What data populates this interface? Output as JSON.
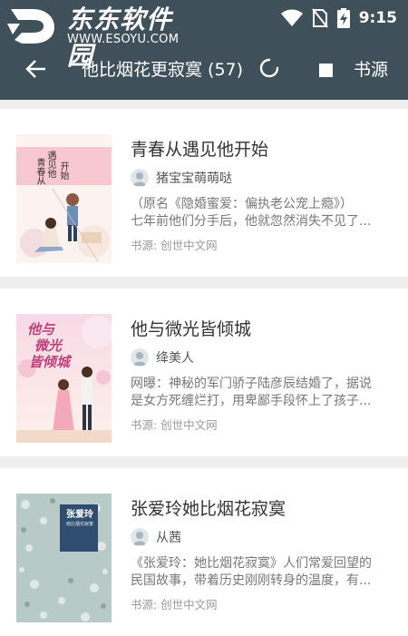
{
  "status_bar": {
    "watermark_title": "东东软件园",
    "watermark_url": "WWW.ESOYU.COM",
    "time": "9:15",
    "icons": [
      "wifi-icon",
      "no-sim-icon",
      "battery-charging-icon"
    ]
  },
  "toolbar": {
    "back_icon": "arrow-left-icon",
    "title": "他比烟花更寂寞 (57)",
    "loading": true,
    "stop_icon": "stop-square-icon",
    "source_label": "书源"
  },
  "results": [
    {
      "title": "青春从遇见他开始",
      "author": "猪宝宝萌萌哒",
      "description": [
        "（原名《隐婚蜜爱：偏执老公宠上瘾》）",
        "七年前他们分手后，他就忽然消失不见了..."
      ],
      "source": "书源: 创世中文网",
      "cover_text": [
        "遇见他",
        "青春从",
        "开始"
      ]
    },
    {
      "title": "他与微光皆倾城",
      "author": "绛美人",
      "description": [
        "网曝：神秘的军门骄子陆彦辰结婚了，据说",
        "是女方死缠烂打，用卑鄙手段怀上了孩子..."
      ],
      "source": "书源: 创世中文网",
      "cover_text": [
        "他与",
        "微光",
        "皆倾城"
      ]
    },
    {
      "title": "张爱玲她比烟花寂寞",
      "author": "从茜",
      "description": [
        "《张爱玲：她比烟花寂寞》人们常爱回望的",
        "民国故事，带着历史刚刚转身的温度，有..."
      ],
      "source": "书源: 创世中文网",
      "cover_text": [
        "张爱玲",
        "她比烟花寂寞"
      ]
    }
  ],
  "colors": {
    "toolbar_bg": "#3f505a",
    "page_bg": "#eeeeee",
    "card_bg": "#ffffff",
    "title_text": "#333333",
    "secondary_text": "#777777"
  }
}
